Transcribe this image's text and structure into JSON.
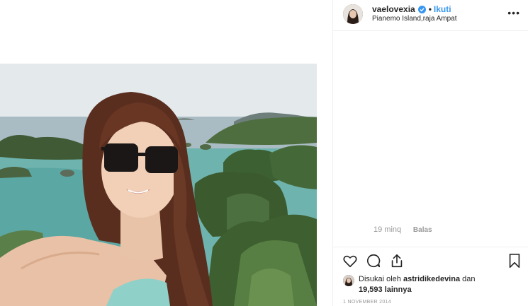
{
  "post": {
    "username": "vaelovexia",
    "separator": "•",
    "follow_label": "Ikuti",
    "location": "Pianemo Island,raja Ampat",
    "more_label": "•••"
  },
  "comment": {
    "time": "19 minq",
    "reply_label": "Balas"
  },
  "likes": {
    "prefix": "Disukai oleh ",
    "user": "astridikedevina",
    "conjunction": " dan ",
    "count": "19,593 lainnya"
  },
  "date": "1 NOVEMBER 2014",
  "colors": {
    "link_blue": "#3897f0",
    "text": "#262626",
    "muted": "#999999",
    "border": "#efefef"
  },
  "icons": {
    "verified": "verified-badge-icon",
    "like": "heart-icon",
    "comment": "comment-bubble-icon",
    "share": "share-icon",
    "save": "bookmark-icon",
    "more": "more-options-icon"
  }
}
